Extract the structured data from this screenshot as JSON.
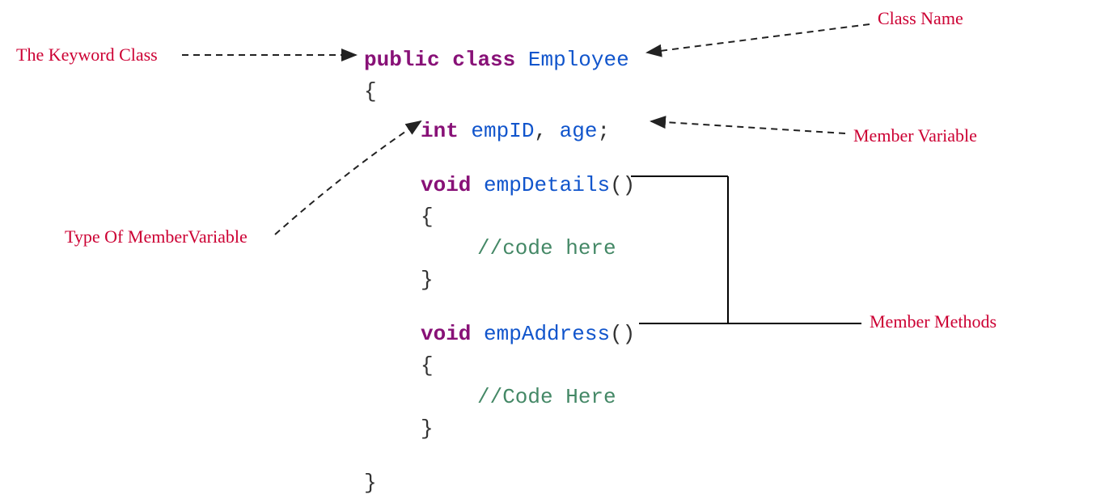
{
  "labels": {
    "keyword_class": "The Keyword Class",
    "class_name": "Class Name",
    "member_variable": "Member Variable",
    "type_of_member": "Type Of MemberVariable",
    "member_methods": "Member  Methods"
  },
  "code": {
    "public": "public",
    "class": "class",
    "classname": "Employee",
    "open_brace": "{",
    "close_brace": "}",
    "int_type": "int",
    "var1": "empID",
    "comma": ",",
    "var2": "age",
    "semi": ";",
    "void1": "void",
    "method1": "empDetails",
    "parens": "()",
    "comment1": "//code here",
    "void2": "void",
    "method2": "empAddress",
    "comment2": "//Code Here"
  }
}
